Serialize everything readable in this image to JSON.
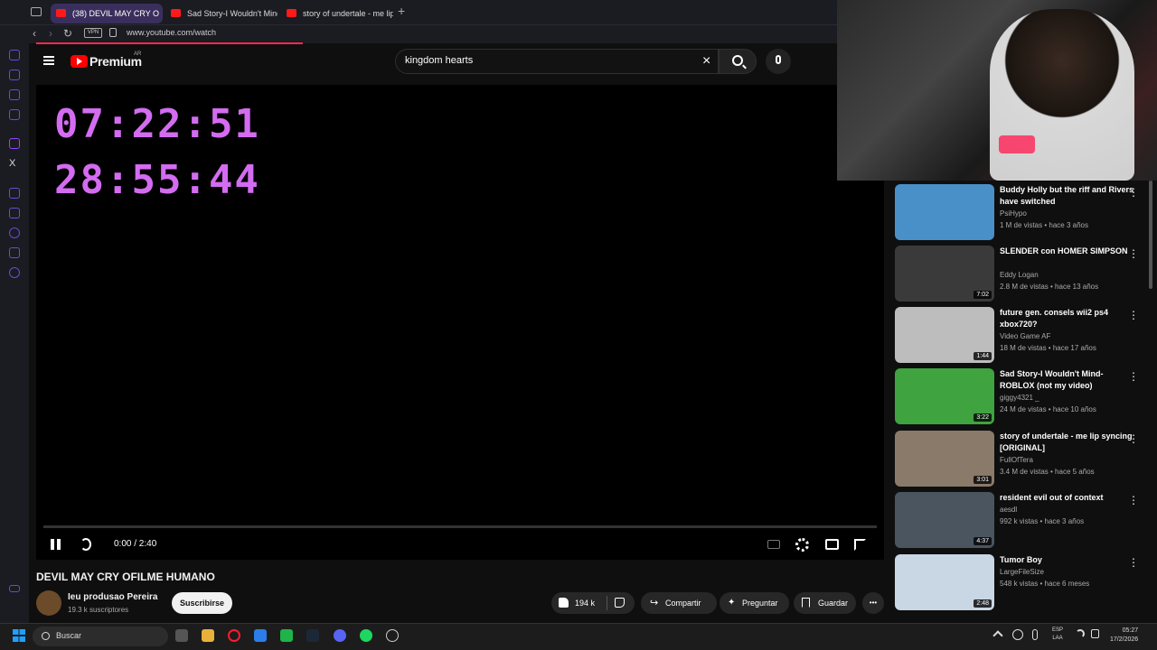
{
  "browser": {
    "tabs": [
      {
        "label": "(38) DEVIL MAY CRY O",
        "active": true
      },
      {
        "label": "Sad Story-I Wouldn't Mind",
        "active": false
      },
      {
        "label": "story of undertale - me lip",
        "active": false
      }
    ],
    "new_tab": "+",
    "vpn": "VPN",
    "url": "www.youtube.com/watch"
  },
  "header": {
    "brand": "Premium",
    "region": "AR",
    "search_query": "kingdom hearts",
    "clear_icon": "×"
  },
  "player": {
    "timer_1": "07:22:51",
    "timer_2": "28:55:44",
    "timecode": "0:00 / 2:40"
  },
  "video": {
    "title": "DEVIL MAY CRY OFILME HUMANO",
    "channel": "Ieu produsao Pereira",
    "subscribers": "19.3 k suscriptores",
    "subscribe_label": "Suscribirse",
    "likes": "194 k",
    "share_label": "Compartir",
    "ask_label": "Preguntar",
    "save_label": "Guardar",
    "more": "•••"
  },
  "recommendations": [
    {
      "title": "Buddy Holly but the riff and Rivers have switched",
      "channel": "PsiHypo",
      "meta": "1 M de vistas • hace 3 años",
      "duration": "",
      "thumb": "#4a90c8"
    },
    {
      "title": "SLENDER con HOMER SIMPSON",
      "channel": "Eddy Logan",
      "meta": "2.8 M de vistas • hace 13 años",
      "duration": "7:02",
      "thumb": "#3a3a3a"
    },
    {
      "title": "future gen. consels wii2 ps4 xbox720?",
      "channel": "Video Game AF",
      "meta": "18 M de vistas • hace 17 años",
      "duration": "1:44",
      "thumb": "#bdbdbd"
    },
    {
      "title": "Sad Story-I Wouldn't Mind-ROBLOX (not my video)",
      "channel": "giggy4321 _",
      "meta": "24 M de vistas • hace 10 años",
      "duration": "3:22",
      "thumb": "#3fa33f"
    },
    {
      "title": "story of undertale - me lip syncing [ORIGINAL]",
      "channel": "FullOfTera",
      "meta": "3.4 M de vistas • hace 5 años",
      "duration": "3:01",
      "thumb": "#8a7a6a"
    },
    {
      "title": "resident evil out of context",
      "channel": "aesdl",
      "meta": "992 k vistas • hace 3 años",
      "duration": "4:37",
      "thumb": "#4a5560"
    },
    {
      "title": "Tumor Boy",
      "channel": "LargeFileSize",
      "meta": "548 k vistas • hace 6 meses",
      "duration": "2:48",
      "thumb": "#c9d6e3"
    }
  ],
  "taskbar": {
    "search_label": "Buscar",
    "lang": "ESP",
    "lang2": "LAA",
    "time": "05:27",
    "date": "17/2/2026"
  }
}
